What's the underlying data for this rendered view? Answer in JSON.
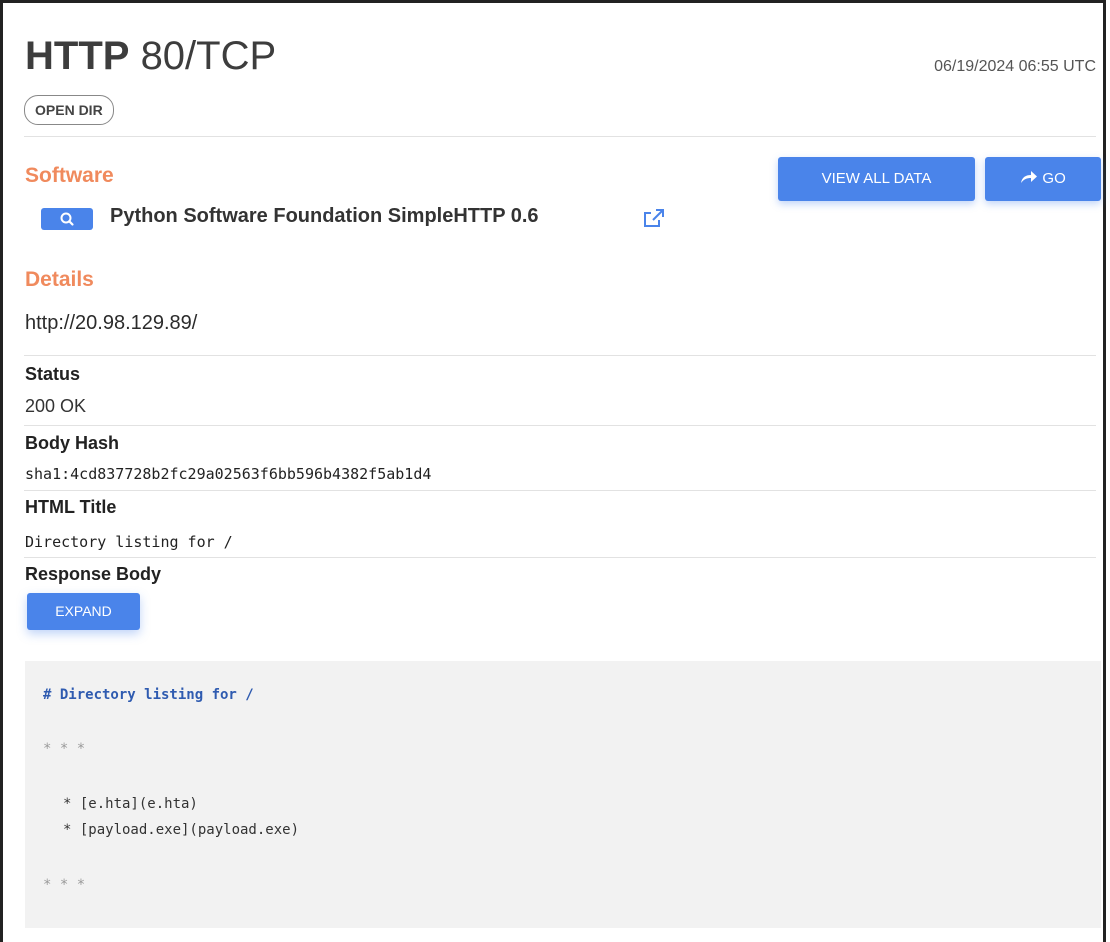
{
  "header": {
    "protocol": "HTTP",
    "port": "80/TCP",
    "timestamp": "06/19/2024 06:55 UTC",
    "badge": "OPEN DIR"
  },
  "software": {
    "heading": "Software",
    "name": "Python Software Foundation SimpleHTTP 0.6",
    "view_all_label": "VIEW ALL DATA",
    "go_label": "GO"
  },
  "details": {
    "heading": "Details",
    "url": "http://20.98.129.89/",
    "status_label": "Status",
    "status_value": "200 OK",
    "body_hash_label": "Body Hash",
    "body_hash_value": "sha1:4cd837728b2fc29a02563f6bb596b4382f5ab1d4",
    "html_title_label": "HTML Title",
    "html_title_value": "Directory listing for /",
    "response_body_label": "Response Body",
    "expand_label": "EXPAND"
  },
  "response_body": {
    "heading_line": "# Directory listing for /",
    "rule_top": "* * *",
    "items": [
      "* [e.hta](e.hta)",
      "* [payload.exe](payload.exe)"
    ],
    "rule_bottom": "* * *"
  },
  "colors": {
    "accent": "#4a84ea",
    "section": "#f08a5d"
  }
}
